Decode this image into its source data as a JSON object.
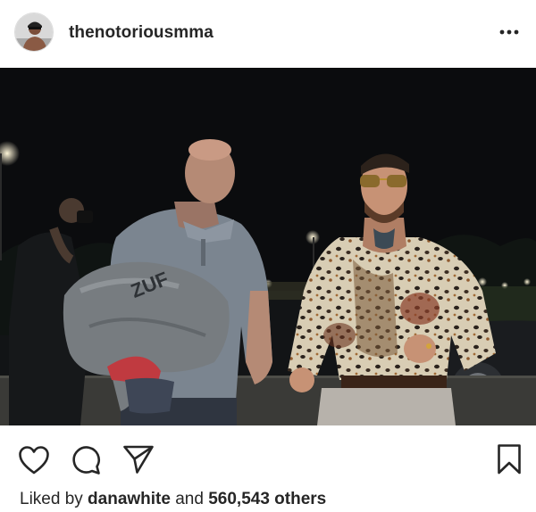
{
  "post": {
    "username": "thenotoriousmma",
    "liked_by_prefix": "Liked by ",
    "liked_by_user": "danawhite",
    "liked_by_and": " and ",
    "liked_by_count": "560,543 others"
  },
  "photo": {
    "jacket_print": "ZUF"
  },
  "icons": {
    "more": "more-options-icon",
    "like": "heart-icon",
    "comment": "comment-icon",
    "share": "share-icon",
    "save": "bookmark-icon"
  },
  "colors": {
    "text": "#262626",
    "divider": "#dbdbdb",
    "photo_background": "#0b0c0e"
  }
}
